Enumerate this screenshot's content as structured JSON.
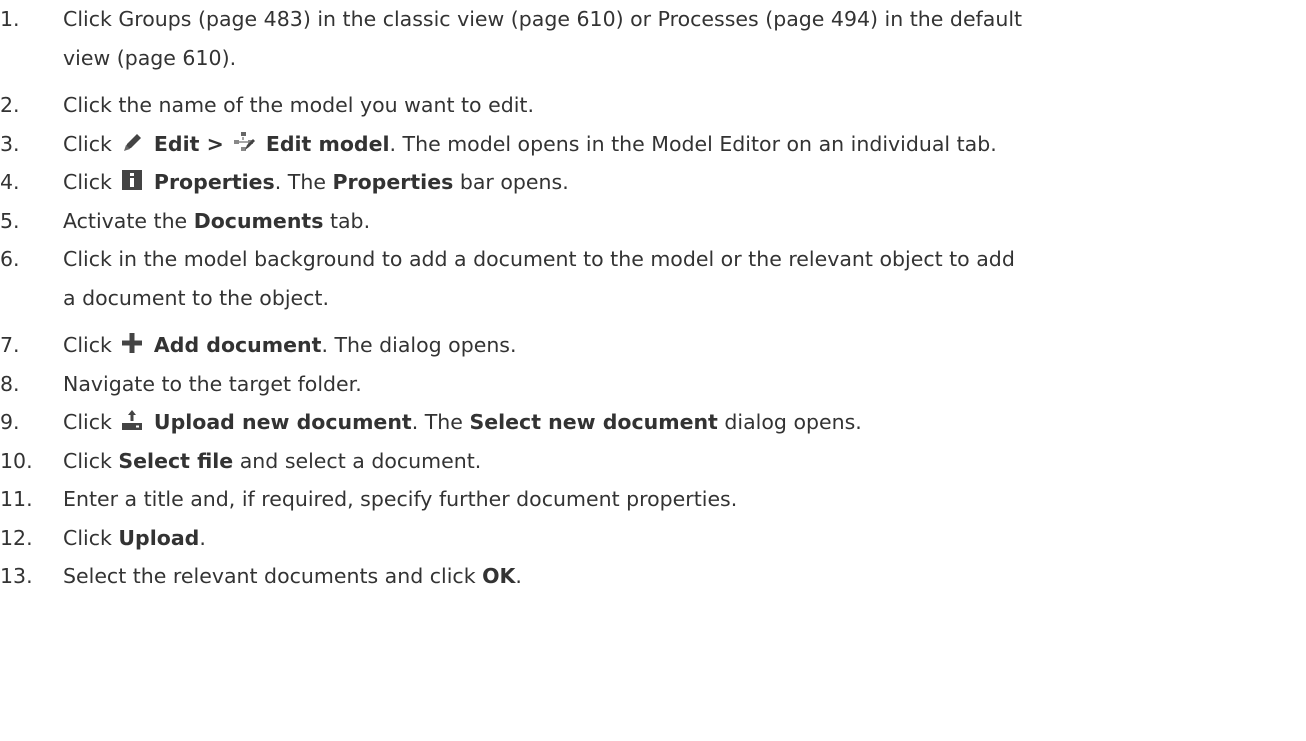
{
  "steps": [
    {
      "num": "1.",
      "line1": "Click Groups (page 483) in the classic view (page 610) or Processes (page 494) in the default",
      "line2": "view (page 610)."
    },
    {
      "num": "2.",
      "text": "Click the name of the model you want to edit."
    },
    {
      "num": "3.",
      "pre": "Click",
      "icon1": "pencil-icon",
      "bold1": "Edit >",
      "icon2": "edit-model-icon",
      "bold2": "Edit model",
      "post": ". The model opens in the Model Editor on an individual tab."
    },
    {
      "num": "4.",
      "pre": "Click",
      "icon": "info-icon",
      "bold1": "Properties",
      "mid": ". The",
      "bold2": "Properties",
      "post": "bar opens."
    },
    {
      "num": "5.",
      "pre": "Activate the",
      "bold": "Documents",
      "post": "tab."
    },
    {
      "num": "6.",
      "line1": "Click in the model background to add a document to the model or the relevant object to add",
      "line2": "a document to the object."
    },
    {
      "num": "7.",
      "pre": "Click",
      "icon": "plus-icon",
      "bold": "Add document",
      "post": ". The dialog opens."
    },
    {
      "num": "8.",
      "text": "Navigate to the target folder."
    },
    {
      "num": "9.",
      "pre": "Click",
      "icon": "upload-icon",
      "bold1": "Upload new document",
      "mid": ". The",
      "bold2": "Select new document",
      "post": "dialog opens."
    },
    {
      "num": "10.",
      "pre": "Click",
      "bold": "Select file",
      "post": "and select a document."
    },
    {
      "num": "11.",
      "text": "Enter a title and, if required, specify further document properties."
    },
    {
      "num": "12.",
      "pre": "Click",
      "bold": "Upload",
      "post": "."
    },
    {
      "num": "13.",
      "pre": "Select the relevant documents and click",
      "bold": "OK",
      "post": "."
    }
  ],
  "colors": {
    "text": "#333333",
    "icon": "#444444"
  }
}
